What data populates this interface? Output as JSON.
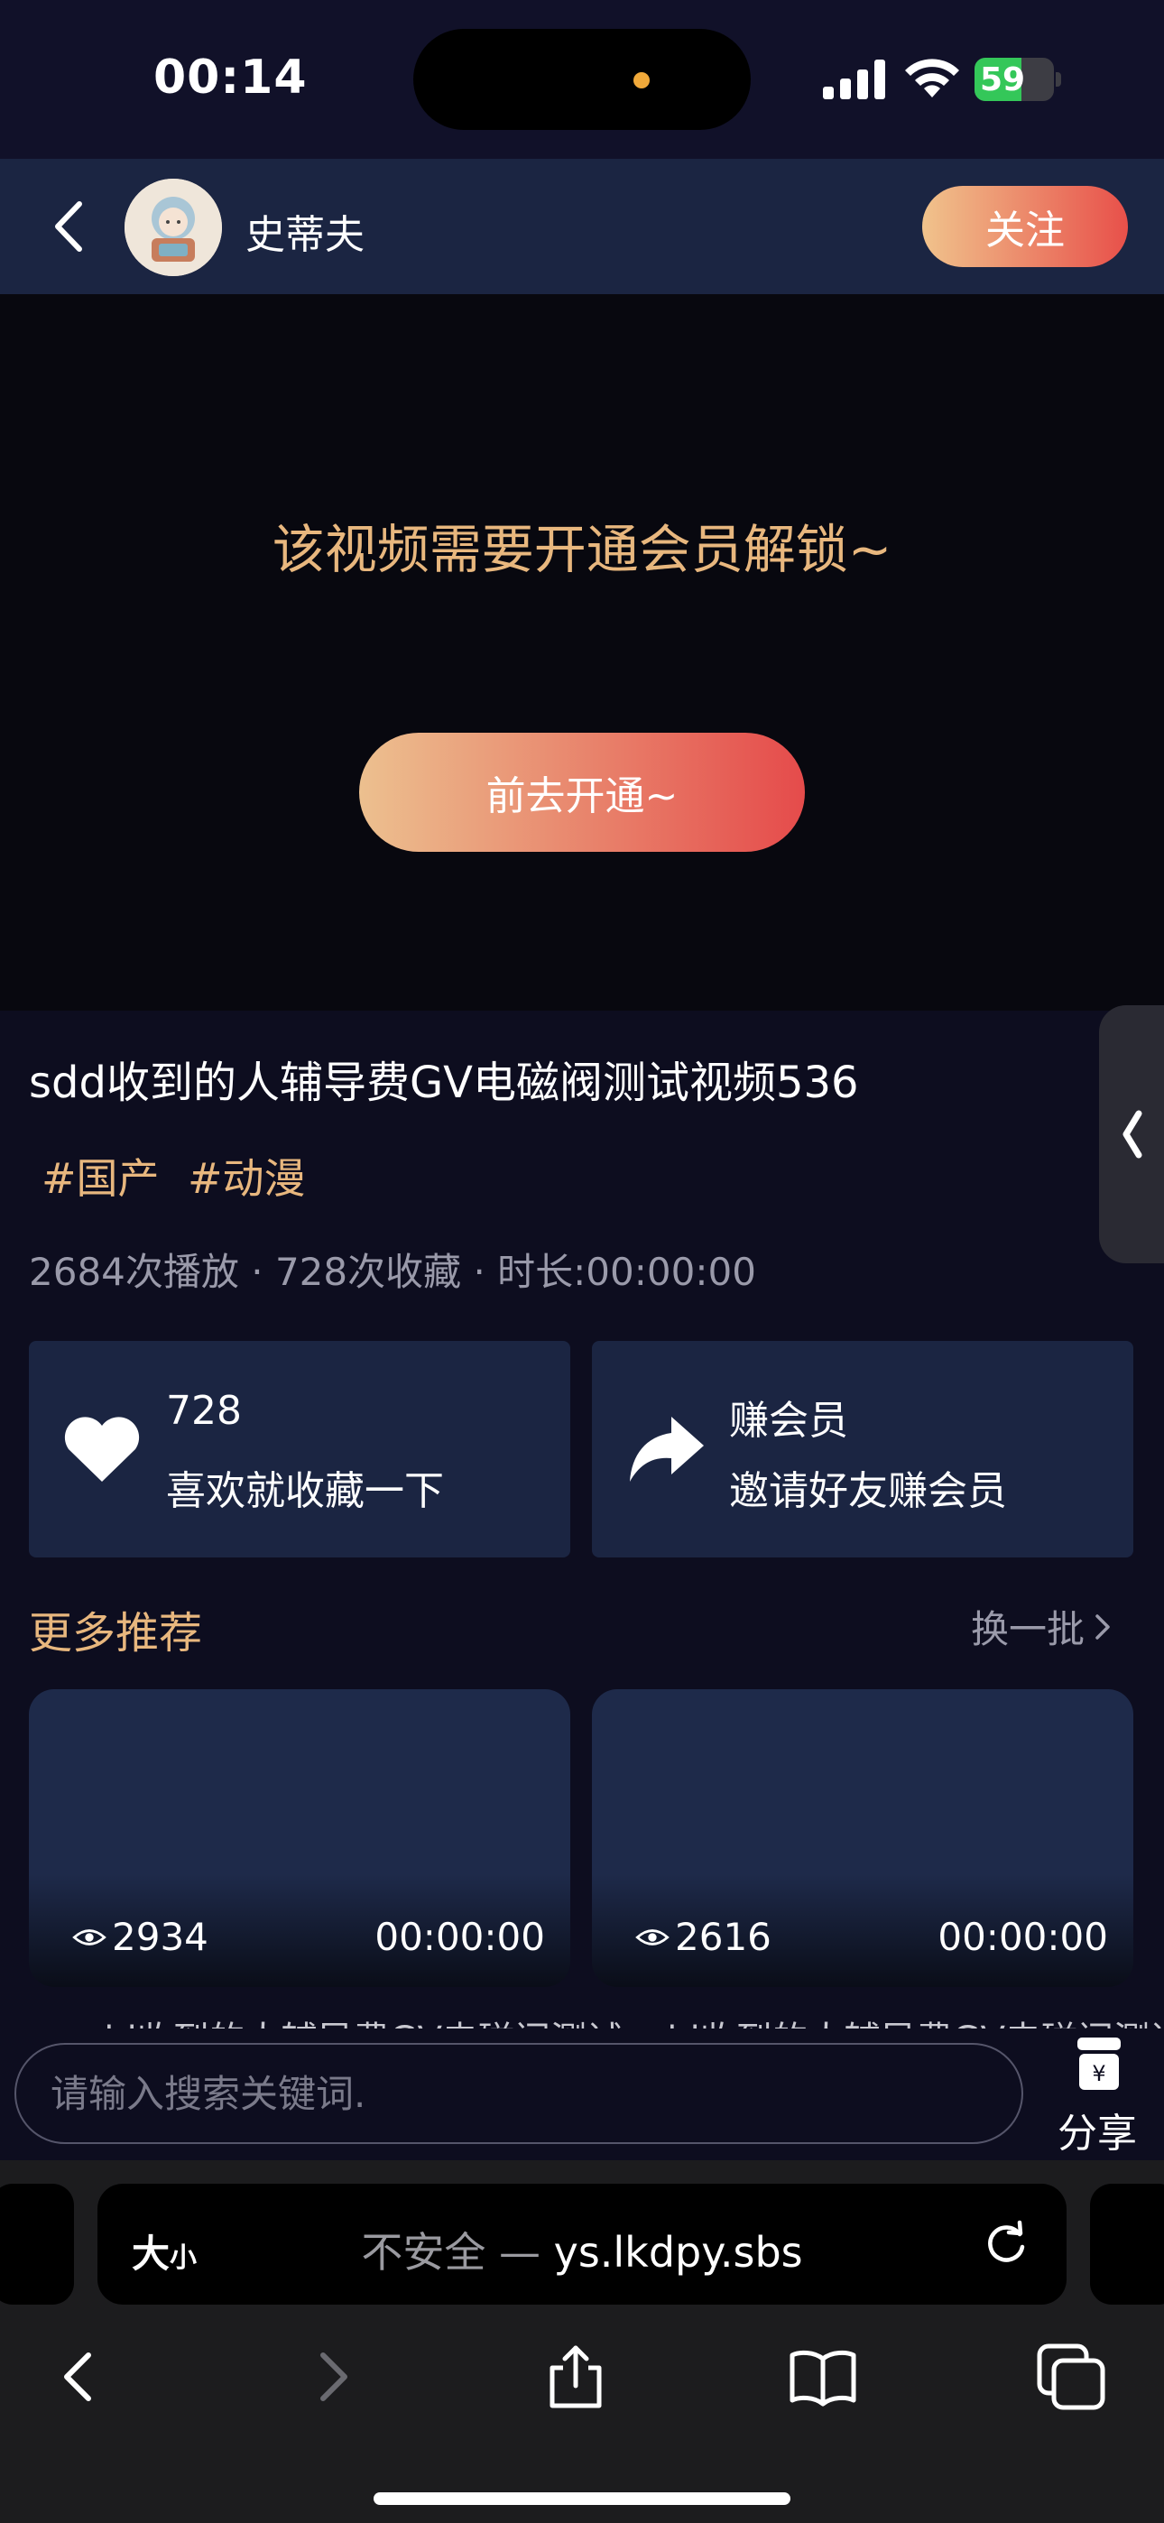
{
  "status_bar": {
    "time": "00:14",
    "battery": "59",
    "battery_level": 0.59
  },
  "header": {
    "author": "史蒂夫",
    "follow_label": "关注"
  },
  "video": {
    "locked_message": "该视频需要开通会员解锁~",
    "unlock_label": "前去开通~",
    "title": "sdd收到的人辅导费GV电磁阀测试视频536",
    "tags": [
      "#国产",
      "#动漫"
    ],
    "stats": "2684次播放 · 728次收藏 · 时长:00:00:00"
  },
  "actions": {
    "collect": {
      "count": "728",
      "label": "喜欢就收藏一下"
    },
    "invite": {
      "title": "赚会员",
      "label": "邀请好友赚会员"
    }
  },
  "recommend": {
    "title": "更多推荐",
    "refresh_label": "换一批",
    "items": [
      {
        "views": "2934",
        "duration": "00:00:00",
        "title": "sdd收到的人辅导费GV电磁阀测试"
      },
      {
        "views": "2616",
        "duration": "00:00:00",
        "title": "sdd收到的人辅导费GV电磁阀测试"
      }
    ]
  },
  "search": {
    "placeholder": "请输入搜索关键词.",
    "share_label": "分享"
  },
  "browser": {
    "text_size_big": "大",
    "text_size_small": "小",
    "insecure_label": "不安全 — ",
    "domain": "ys.lkdpy.sbs"
  },
  "colors": {
    "accent_gold": "#e8b77e",
    "header_bg": "#1b2542",
    "gradient_start": "#ecc08f",
    "gradient_end": "#e54b4b"
  }
}
